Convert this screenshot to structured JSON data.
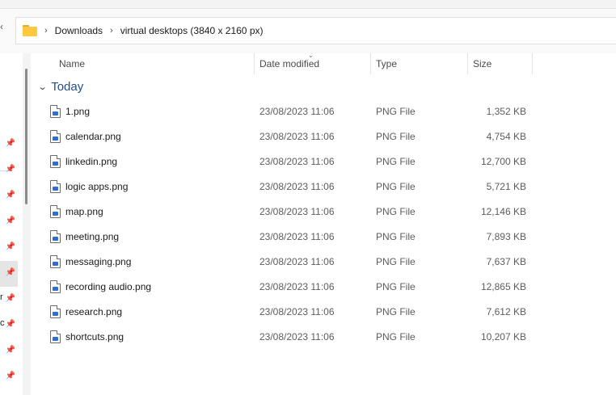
{
  "breadcrumb": {
    "items": [
      "Downloads",
      "virtual desktops (3840 x 2160 px)"
    ],
    "separator": "›"
  },
  "columns": {
    "name": "Name",
    "date_modified": "Date modified",
    "type": "Type",
    "size": "Size"
  },
  "group": {
    "label": "Today"
  },
  "files": [
    {
      "name": "1.png",
      "date": "23/08/2023 11:06",
      "type": "PNG File",
      "size": "1,352 KB"
    },
    {
      "name": "calendar.png",
      "date": "23/08/2023 11:06",
      "type": "PNG File",
      "size": "4,754 KB"
    },
    {
      "name": "linkedin.png",
      "date": "23/08/2023 11:06",
      "type": "PNG File",
      "size": "12,700 KB"
    },
    {
      "name": "logic apps.png",
      "date": "23/08/2023 11:06",
      "type": "PNG File",
      "size": "5,721 KB"
    },
    {
      "name": "map.png",
      "date": "23/08/2023 11:06",
      "type": "PNG File",
      "size": "12,146 KB"
    },
    {
      "name": "meeting.png",
      "date": "23/08/2023 11:06",
      "type": "PNG File",
      "size": "7,893 KB"
    },
    {
      "name": "messaging.png",
      "date": "23/08/2023 11:06",
      "type": "PNG File",
      "size": "7,637 KB"
    },
    {
      "name": "recording audio.png",
      "date": "23/08/2023 11:06",
      "type": "PNG File",
      "size": "12,865 KB"
    },
    {
      "name": "research.png",
      "date": "23/08/2023 11:06",
      "type": "PNG File",
      "size": "7,612 KB"
    },
    {
      "name": "shortcuts.png",
      "date": "23/08/2023 11:06",
      "type": "PNG File",
      "size": "10,207 KB"
    }
  ],
  "sidebar": {
    "fragments": [
      "r",
      "c"
    ],
    "icons": "pin-icon"
  },
  "colors": {
    "accent": "#1f4e8c",
    "folder": "#ffc83d",
    "file_badge": "#2b6fd6"
  }
}
